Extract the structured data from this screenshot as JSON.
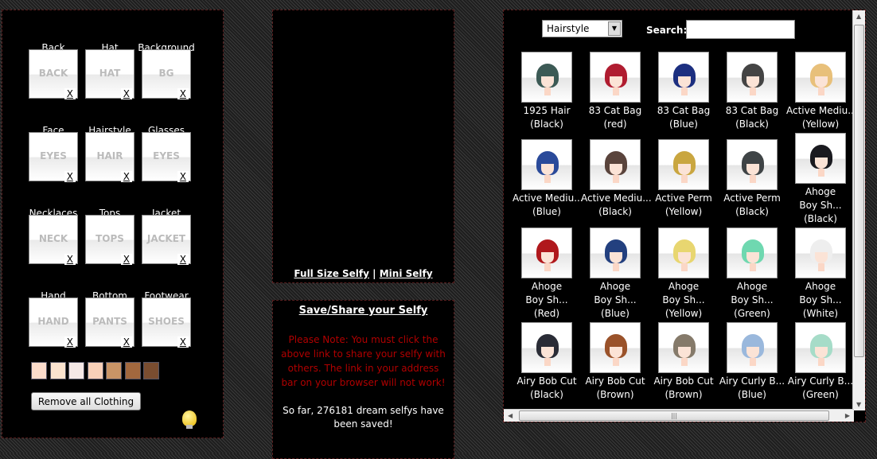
{
  "slots": [
    {
      "label": "Back",
      "placeholder": "BACK",
      "remove": "X"
    },
    {
      "label": "Hat",
      "placeholder": "HAT",
      "remove": "X"
    },
    {
      "label": "Background",
      "placeholder": "BG",
      "remove": "X"
    },
    {
      "label": "Face",
      "placeholder": "EYES",
      "remove": "X"
    },
    {
      "label": "Hairstyle",
      "placeholder": "HAIR",
      "remove": "X"
    },
    {
      "label": "Glasses",
      "placeholder": "EYES",
      "remove": "X"
    },
    {
      "label": "Necklaces",
      "placeholder": "NECK",
      "remove": "X"
    },
    {
      "label": "Tops",
      "placeholder": "TOPS",
      "remove": "X"
    },
    {
      "label": "Jacket",
      "placeholder": "JACKET",
      "remove": "X"
    },
    {
      "label": "Hand",
      "placeholder": "HAND",
      "remove": "X"
    },
    {
      "label": "Bottom",
      "placeholder": "PANTS",
      "remove": "X"
    },
    {
      "label": "Footwear",
      "placeholder": "SHOES",
      "remove": "X"
    }
  ],
  "skin_tones": [
    "#fcdccb",
    "#fbe3cf",
    "#f5e8e6",
    "#f8d0b8",
    "#c99466",
    "#a2683e",
    "#7a4d30"
  ],
  "remove_all_label": "Remove all Clothing",
  "hint_icon": "lightbulb-icon",
  "preview": {
    "full_size": "Full Size Selfy",
    "separator": "|",
    "mini": "Mini Selfy"
  },
  "share": {
    "title": "Save/Share your Selfy",
    "note": "Please Note: You must click the above link to share your selfy with others. The link in your address bar on your browser will not work!",
    "count_text": "So far, 276181 dream selfys have been saved!"
  },
  "browser": {
    "category": "Hairstyle",
    "search_label": "Search:",
    "search_value": "",
    "items": [
      {
        "name": "1925 Hair",
        "variant": "(Black)",
        "color": "#3c5a55"
      },
      {
        "name": "83 Cat Bag",
        "variant": "(red)",
        "color": "#b01c30"
      },
      {
        "name": "83 Cat Bag",
        "variant": "(Blue)",
        "color": "#1c2f80"
      },
      {
        "name": "83 Cat Bag",
        "variant": "(Black)",
        "color": "#444444"
      },
      {
        "name": "Active Mediu...",
        "variant": "(Yellow)",
        "color": "#e8c07a"
      },
      {
        "name": "Active Mediu...",
        "variant": "(Blue)",
        "color": "#2a4a9a"
      },
      {
        "name": "Active Mediu...",
        "variant": "(Black)",
        "color": "#5a443c"
      },
      {
        "name": "Active Perm",
        "variant": "(Yellow)",
        "color": "#c9a640"
      },
      {
        "name": "Active Perm",
        "variant": "(Black)",
        "color": "#3f4446"
      },
      {
        "name": "Ahoge Boy Sh...",
        "variant": "(Black)",
        "color": "#1a1a1f"
      },
      {
        "name": "Ahoge Boy Sh...",
        "variant": "(Red)",
        "color": "#b0181c"
      },
      {
        "name": "Ahoge Boy Sh...",
        "variant": "(Blue)",
        "color": "#23407f"
      },
      {
        "name": "Ahoge Boy Sh...",
        "variant": "(Yellow)",
        "color": "#e8d670"
      },
      {
        "name": "Ahoge Boy Sh...",
        "variant": "(Green)",
        "color": "#6fd8b0"
      },
      {
        "name": "Ahoge Boy Sh...",
        "variant": "(White)",
        "color": "#eeeeee"
      },
      {
        "name": "Airy Bob Cut",
        "variant": "(Black)",
        "color": "#2a2c36"
      },
      {
        "name": "Airy Bob Cut",
        "variant": "(Brown)",
        "color": "#9a522a"
      },
      {
        "name": "Airy Bob Cut",
        "variant": "(Brown)",
        "color": "#857a6a"
      },
      {
        "name": "Airy Curly B...",
        "variant": "(Blue)",
        "color": "#9ab8dc"
      },
      {
        "name": "Airy Curly B...",
        "variant": "(Green)",
        "color": "#a6dcc8"
      }
    ]
  }
}
